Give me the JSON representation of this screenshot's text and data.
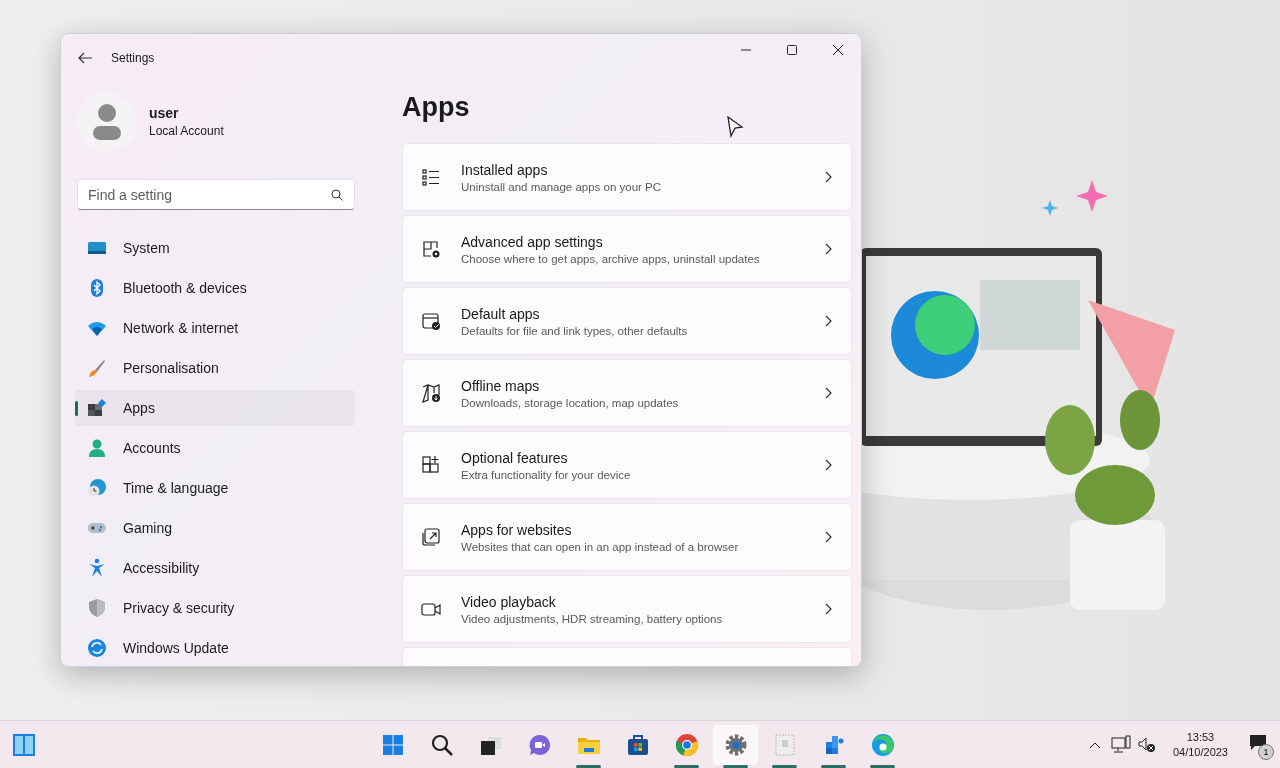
{
  "window": {
    "title": "Settings"
  },
  "account": {
    "name": "user",
    "type": "Local Account"
  },
  "search": {
    "placeholder": "Find a setting"
  },
  "nav": [
    {
      "label": "System",
      "kind": "system",
      "selected": false
    },
    {
      "label": "Bluetooth & devices",
      "kind": "bluetooth",
      "selected": false
    },
    {
      "label": "Network & internet",
      "kind": "network",
      "selected": false
    },
    {
      "label": "Personalisation",
      "kind": "brush",
      "selected": false
    },
    {
      "label": "Apps",
      "kind": "apps",
      "selected": true
    },
    {
      "label": "Accounts",
      "kind": "person",
      "selected": false
    },
    {
      "label": "Time & language",
      "kind": "globe",
      "selected": false
    },
    {
      "label": "Gaming",
      "kind": "gamepad",
      "selected": false
    },
    {
      "label": "Accessibility",
      "kind": "accessibility",
      "selected": false
    },
    {
      "label": "Privacy & security",
      "kind": "shield",
      "selected": false
    },
    {
      "label": "Windows Update",
      "kind": "update",
      "selected": false
    }
  ],
  "page_title": "Apps",
  "cards": [
    {
      "title": "Installed apps",
      "subtitle": "Uninstall and manage apps on your PC",
      "kind": "list"
    },
    {
      "title": "Advanced app settings",
      "subtitle": "Choose where to get apps, archive apps, uninstall updates",
      "kind": "gear-grid"
    },
    {
      "title": "Default apps",
      "subtitle": "Defaults for file and link types, other defaults",
      "kind": "check-window"
    },
    {
      "title": "Offline maps",
      "subtitle": "Downloads, storage location, map updates",
      "kind": "map"
    },
    {
      "title": "Optional features",
      "subtitle": "Extra functionality for your device",
      "kind": "add-grid"
    },
    {
      "title": "Apps for websites",
      "subtitle": "Websites that can open in an app instead of a browser",
      "kind": "open-window"
    },
    {
      "title": "Video playback",
      "subtitle": "Video adjustments, HDR streaming, battery options",
      "kind": "video"
    }
  ],
  "taskbar": {
    "apps": [
      {
        "kind": "start",
        "running": false,
        "selected": false
      },
      {
        "kind": "search",
        "running": false,
        "selected": false
      },
      {
        "kind": "taskview",
        "running": false,
        "selected": false
      },
      {
        "kind": "chat",
        "running": false,
        "selected": false
      },
      {
        "kind": "folder",
        "running": true,
        "selected": false
      },
      {
        "kind": "store",
        "running": false,
        "selected": false
      },
      {
        "kind": "browser",
        "running": true,
        "selected": false
      },
      {
        "kind": "settings",
        "running": true,
        "selected": true
      },
      {
        "kind": "blank",
        "running": true,
        "selected": false
      },
      {
        "kind": "cubes",
        "running": true,
        "selected": false
      },
      {
        "kind": "edge",
        "running": true,
        "selected": false
      }
    ],
    "tray": {
      "time": "13:53",
      "date": "04/10/2023",
      "notifications": "1"
    }
  }
}
